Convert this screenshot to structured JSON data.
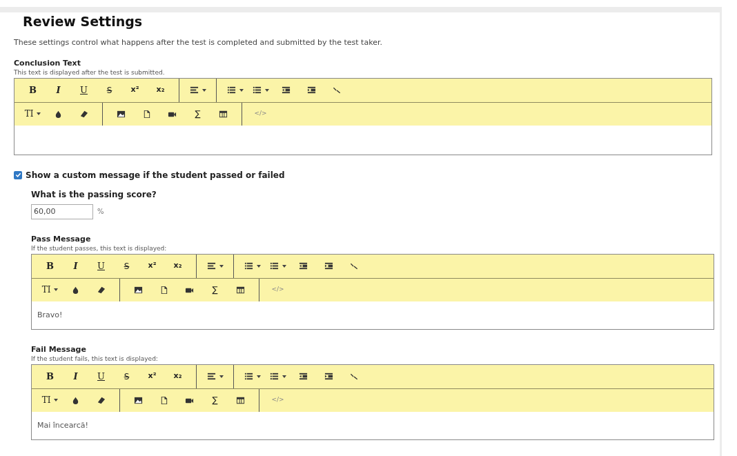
{
  "title": "Review Settings",
  "description": "These settings control what happens after the test is completed and submitted by the test taker.",
  "conclusion": {
    "label": "Conclusion Text",
    "hint": "This text is displayed after the test is submitted.",
    "editor": {
      "toolbar": [
        [
          [
            {
              "kind": "bold",
              "label": "B",
              "dropdown": false
            },
            {
              "kind": "italic",
              "label": "I",
              "dropdown": false
            },
            {
              "kind": "underline",
              "label": "U",
              "dropdown": false
            },
            {
              "kind": "strike",
              "label": "S",
              "dropdown": false
            },
            {
              "kind": "superscript",
              "label": "x²",
              "dropdown": false
            },
            {
              "kind": "subscript",
              "label": "x₂",
              "dropdown": false
            }
          ],
          [
            {
              "kind": "align",
              "dropdown": true
            }
          ],
          [
            {
              "kind": "ordered-list",
              "dropdown": true
            },
            {
              "kind": "bullet-list",
              "dropdown": true
            },
            {
              "kind": "outdent",
              "dropdown": false
            },
            {
              "kind": "indent",
              "dropdown": false
            },
            {
              "kind": "link",
              "dropdown": false
            }
          ]
        ],
        [
          [
            {
              "kind": "font-size",
              "label": "TI",
              "dropdown": true
            },
            {
              "kind": "color",
              "dropdown": false
            },
            {
              "kind": "eraser",
              "dropdown": false
            }
          ],
          [
            {
              "kind": "image",
              "dropdown": false
            },
            {
              "kind": "file",
              "dropdown": false
            },
            {
              "kind": "video",
              "dropdown": false
            },
            {
              "kind": "formula",
              "label": "∑",
              "dropdown": false
            },
            {
              "kind": "table",
              "dropdown": false
            }
          ],
          [
            {
              "kind": "code",
              "label": "</>",
              "dropdown": false
            }
          ]
        ]
      ]
    }
  },
  "custom_message": {
    "label": "Show a custom message if the student passed or failed",
    "checked": true,
    "passing_score": {
      "label": "What is the passing score?",
      "value": "60,00",
      "unit": "%"
    },
    "messages": [
      {
        "label": "Pass Message",
        "hint": "If the student passes, this text is displayed:",
        "editor": {
          "value": "Bravo!",
          "toolbar": [
            [
              [
                {
                  "kind": "bold",
                  "label": "B",
                  "dropdown": false
                },
                {
                  "kind": "italic",
                  "label": "I",
                  "dropdown": false
                },
                {
                  "kind": "underline",
                  "label": "U",
                  "dropdown": false
                },
                {
                  "kind": "strike",
                  "label": "S",
                  "dropdown": false
                },
                {
                  "kind": "superscript",
                  "label": "x²",
                  "dropdown": false
                },
                {
                  "kind": "subscript",
                  "label": "x₂",
                  "dropdown": false
                }
              ],
              [
                {
                  "kind": "align",
                  "dropdown": true
                }
              ],
              [
                {
                  "kind": "ordered-list",
                  "dropdown": true
                },
                {
                  "kind": "bullet-list",
                  "dropdown": true
                },
                {
                  "kind": "outdent",
                  "dropdown": false
                },
                {
                  "kind": "indent",
                  "dropdown": false
                },
                {
                  "kind": "link",
                  "dropdown": false
                }
              ]
            ],
            [
              [
                {
                  "kind": "font-size",
                  "label": "TI",
                  "dropdown": true
                },
                {
                  "kind": "color",
                  "dropdown": false
                },
                {
                  "kind": "eraser",
                  "dropdown": false
                }
              ],
              [
                {
                  "kind": "image",
                  "dropdown": false
                },
                {
                  "kind": "file",
                  "dropdown": false
                },
                {
                  "kind": "video",
                  "dropdown": false
                },
                {
                  "kind": "formula",
                  "label": "∑",
                  "dropdown": false
                },
                {
                  "kind": "table",
                  "dropdown": false
                }
              ],
              [
                {
                  "kind": "code",
                  "label": "</>",
                  "dropdown": false
                }
              ]
            ]
          ]
        }
      },
      {
        "label": "Fail Message",
        "hint": "If the student fails, this text is displayed:",
        "editor": {
          "value": "Mai încearcă!",
          "toolbar": [
            [
              [
                {
                  "kind": "bold",
                  "label": "B",
                  "dropdown": false
                },
                {
                  "kind": "italic",
                  "label": "I",
                  "dropdown": false
                },
                {
                  "kind": "underline",
                  "label": "U",
                  "dropdown": false
                },
                {
                  "kind": "strike",
                  "label": "S",
                  "dropdown": false
                },
                {
                  "kind": "superscript",
                  "label": "x²",
                  "dropdown": false
                },
                {
                  "kind": "subscript",
                  "label": "x₂",
                  "dropdown": false
                }
              ],
              [
                {
                  "kind": "align",
                  "dropdown": true
                }
              ],
              [
                {
                  "kind": "ordered-list",
                  "dropdown": true
                },
                {
                  "kind": "bullet-list",
                  "dropdown": true
                },
                {
                  "kind": "outdent",
                  "dropdown": false
                },
                {
                  "kind": "indent",
                  "dropdown": false
                },
                {
                  "kind": "link",
                  "dropdown": false
                }
              ]
            ],
            [
              [
                {
                  "kind": "font-size",
                  "label": "TI",
                  "dropdown": true
                },
                {
                  "kind": "color",
                  "dropdown": false
                },
                {
                  "kind": "eraser",
                  "dropdown": false
                }
              ],
              [
                {
                  "kind": "image",
                  "dropdown": false
                },
                {
                  "kind": "file",
                  "dropdown": false
                },
                {
                  "kind": "video",
                  "dropdown": false
                },
                {
                  "kind": "formula",
                  "label": "∑",
                  "dropdown": false
                },
                {
                  "kind": "table",
                  "dropdown": false
                }
              ],
              [
                {
                  "kind": "code",
                  "label": "</>",
                  "dropdown": false
                }
              ]
            ]
          ]
        }
      }
    ]
  }
}
